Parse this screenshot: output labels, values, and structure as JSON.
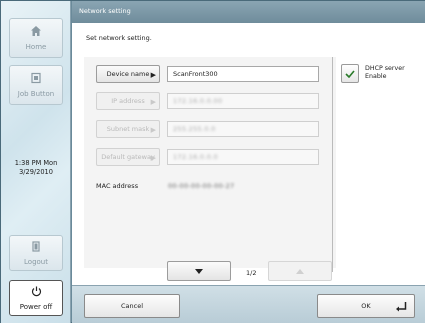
{
  "sidebar": {
    "home": {
      "label": "Home",
      "icon": "home-icon"
    },
    "job_button": {
      "label": "Job Button",
      "icon": "job-button-icon"
    },
    "clock": {
      "time": "1:38 PM  Mon",
      "date": "3/29/2010"
    },
    "logout": {
      "label": "Logout",
      "icon": "logout-icon"
    },
    "power_off": {
      "label": "Power off",
      "icon": "power-icon"
    }
  },
  "header": {
    "title": "Network setting"
  },
  "main": {
    "instruction": "Set network setting.",
    "rows": [
      {
        "label": "Device name",
        "value": "ScanFront300",
        "enabled": true
      },
      {
        "label": "IP address",
        "value": "172.16.0.0.00",
        "enabled": false
      },
      {
        "label": "Subnet mask",
        "value": "255.255.0.0",
        "enabled": false
      },
      {
        "label": "Default gateway",
        "value": "172.16.0.0.0",
        "enabled": false
      }
    ],
    "mac_label": "MAC address",
    "mac_value": "00-00-00-00-00-27",
    "dhcp": {
      "label_line1": "DHCP server",
      "label_line2": "Enable",
      "checked": true
    },
    "pager": {
      "indicator": "1/2",
      "down_icon": "triangle-down-icon",
      "up_icon": "triangle-up-icon"
    }
  },
  "footer": {
    "cancel_label": "Cancel",
    "ok_label": "OK",
    "ok_icon": "enter-icon"
  },
  "colors": {
    "accent": "#2a7a2a",
    "titlebar": "#7a96a5"
  }
}
